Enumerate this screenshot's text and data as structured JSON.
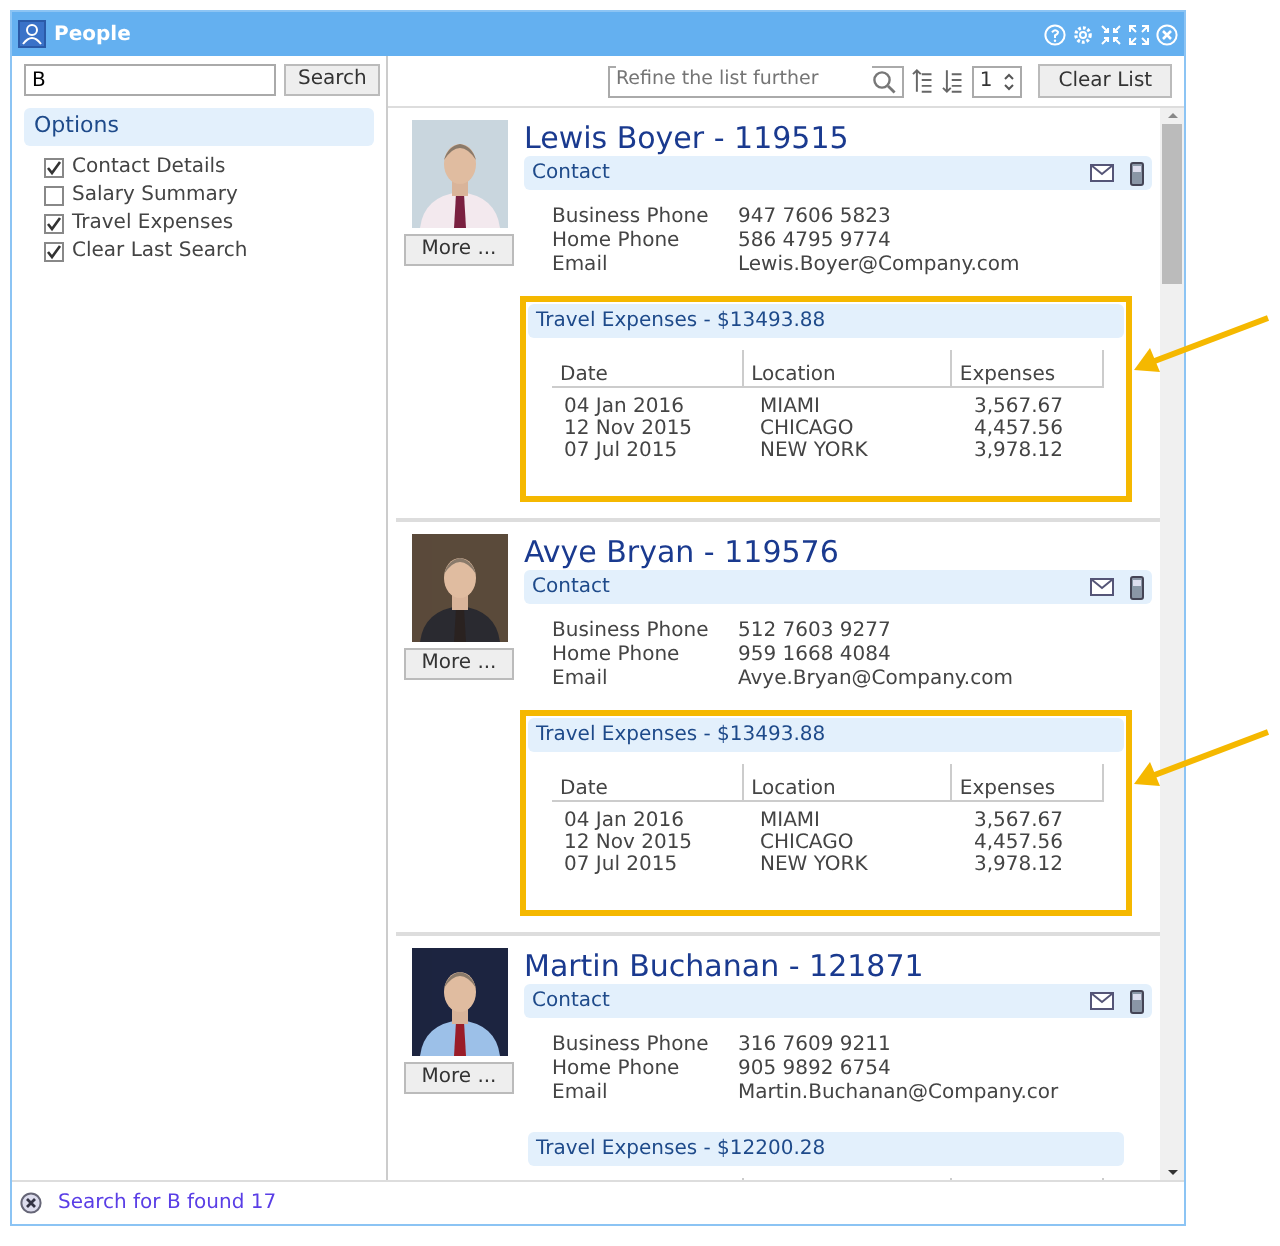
{
  "window": {
    "title": "People"
  },
  "search": {
    "value": "B",
    "button": "Search"
  },
  "options": {
    "title": "Options",
    "items": [
      {
        "label": "Contact Details",
        "checked": true
      },
      {
        "label": "Salary Summary",
        "checked": false
      },
      {
        "label": "Travel Expenses",
        "checked": true
      },
      {
        "label": "Clear Last Search",
        "checked": true
      }
    ]
  },
  "toolbar": {
    "refine_placeholder": "Refine the list further",
    "page": "1",
    "clear_button": "Clear List"
  },
  "people": [
    {
      "name": "Lewis Boyer - 119515",
      "more": "More ...",
      "contact_title": "Contact",
      "contact": [
        {
          "label": "Business Phone",
          "value": "947 7606 5823"
        },
        {
          "label": "Home Phone",
          "value": "586 4795 9774"
        },
        {
          "label": "Email",
          "value": "Lewis.Boyer@Company.com"
        }
      ],
      "expenses": {
        "title": "Travel Expenses - $13493.88",
        "highlighted": true,
        "columns": [
          "Date",
          "Location",
          "Expenses"
        ],
        "rows": [
          [
            "04 Jan 2016",
            "MIAMI",
            "3,567.67"
          ],
          [
            "12 Nov 2015",
            "CHICAGO",
            "4,457.56"
          ],
          [
            "07 Jul 2015",
            "NEW YORK",
            "3,978.12"
          ]
        ]
      }
    },
    {
      "name": "Avye Bryan - 119576",
      "more": "More ...",
      "contact_title": "Contact",
      "contact": [
        {
          "label": "Business Phone",
          "value": "512 7603 9277"
        },
        {
          "label": "Home Phone",
          "value": "959 1668 4084"
        },
        {
          "label": "Email",
          "value": "Avye.Bryan@Company.com"
        }
      ],
      "expenses": {
        "title": "Travel Expenses - $13493.88",
        "highlighted": true,
        "columns": [
          "Date",
          "Location",
          "Expenses"
        ],
        "rows": [
          [
            "04 Jan 2016",
            "MIAMI",
            "3,567.67"
          ],
          [
            "12 Nov 2015",
            "CHICAGO",
            "4,457.56"
          ],
          [
            "07 Jul 2015",
            "NEW YORK",
            "3,978.12"
          ]
        ]
      }
    },
    {
      "name": "Martin Buchanan - 121871",
      "more": "More ...",
      "contact_title": "Contact",
      "contact": [
        {
          "label": "Business Phone",
          "value": "316 7609 9211"
        },
        {
          "label": "Home Phone",
          "value": "905 9892 6754"
        },
        {
          "label": "Email",
          "value": "Martin.Buchanan@Company.cor"
        }
      ],
      "expenses": {
        "title": "Travel Expenses - $12200.28",
        "highlighted": false
      }
    }
  ],
  "status_bar": {
    "text": "Search for B found 17"
  }
}
